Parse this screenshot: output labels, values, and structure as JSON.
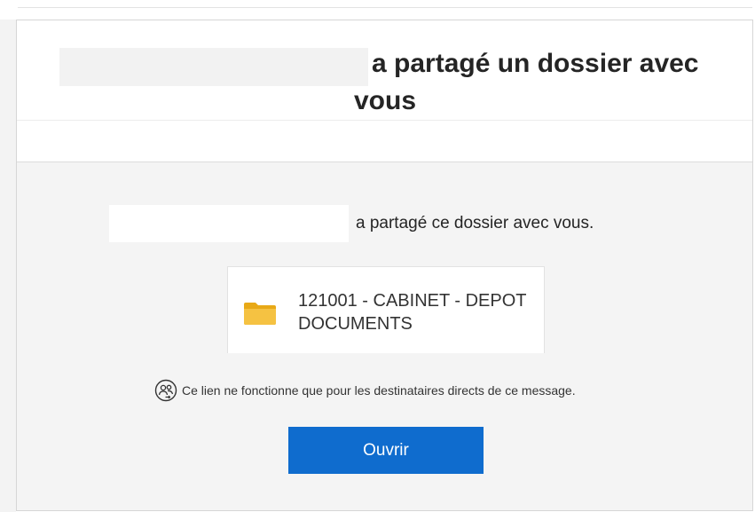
{
  "header": {
    "headline_line1": "a partagé un dossier avec",
    "headline_line2": "vous"
  },
  "body": {
    "shared_text": "a partagé ce dossier avec vous.",
    "folder": {
      "icon": "folder-icon",
      "name": "121001 - CABINET - DEPOT DOCUMENTS"
    },
    "notice": {
      "icon": "people-link-icon",
      "text": "Ce lien ne fonctionne que pour les destinataires directs de ce message."
    },
    "open_button_label": "Ouvrir"
  },
  "colors": {
    "button_blue": "#0f6cce",
    "folder_yellow": "#f5c242",
    "body_background": "#f4f4f4"
  }
}
